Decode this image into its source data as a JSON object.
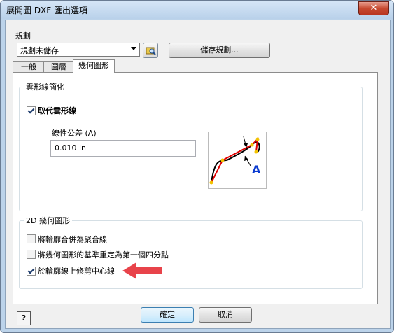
{
  "window": {
    "title": "展開圖 DXF 匯出選項",
    "close_glyph": "✕"
  },
  "planning": {
    "label": "規劃",
    "selected": "規劃未儲存",
    "save_button": "儲存規劃..."
  },
  "tabs": [
    {
      "label": "一般",
      "active": false
    },
    {
      "label": "圖層",
      "active": false
    },
    {
      "label": "幾何圖形",
      "active": true
    }
  ],
  "cloud_group": {
    "title": "雲形線簡化",
    "replace_checkbox": {
      "label": "取代雲形線",
      "checked": true
    },
    "tolerance_label": "線性公差 (A)",
    "tolerance_value": "0.010 in",
    "diagram_letter": "A"
  },
  "geometry_group": {
    "title": "2D 幾何圖形",
    "options": [
      {
        "label": "將輪廓合併為聚合線",
        "checked": false
      },
      {
        "label": "將幾何圖形的基準重定為第一個四分點",
        "checked": false
      },
      {
        "label": "於輪廓線上修剪中心線",
        "checked": true
      }
    ]
  },
  "footer": {
    "help_glyph": "?",
    "ok": "確定",
    "cancel": "取消"
  },
  "colors": {
    "arrow": "#e8434a",
    "accent": "#3c7fb1",
    "titlebar": "#bcd3ea"
  }
}
